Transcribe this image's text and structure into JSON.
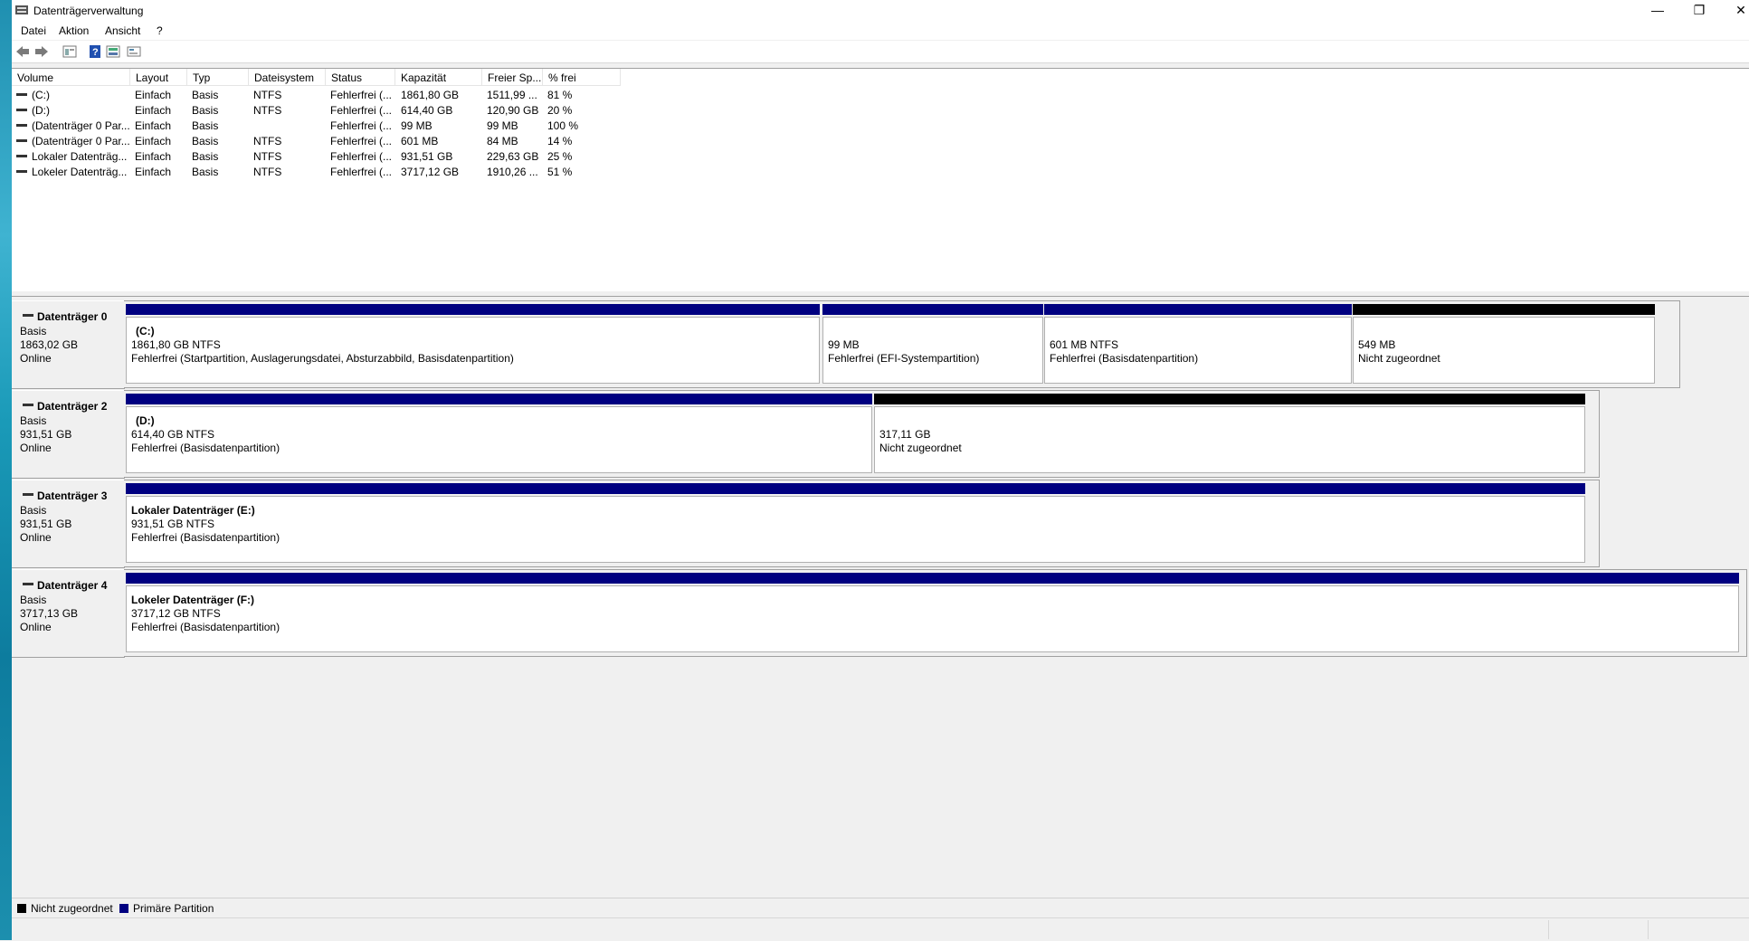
{
  "window": {
    "title": "Datenträgerverwaltung",
    "minimize": "—",
    "restore": "❐",
    "close": "✕"
  },
  "menu": {
    "datei": "Datei",
    "aktion": "Aktion",
    "ansicht": "Ansicht",
    "help": "?"
  },
  "columns": [
    "Volume",
    "Layout",
    "Typ",
    "Dateisystem",
    "Status",
    "Kapazität",
    "Freier Sp...",
    "% frei"
  ],
  "volumes": [
    {
      "volume": "(C:)",
      "layout": "Einfach",
      "typ": "Basis",
      "fs": "NTFS",
      "status": "Fehlerfrei (...",
      "kapazitaet": "1861,80 GB",
      "frei": "1511,99 ...",
      "prozent": "81 %"
    },
    {
      "volume": "(D:)",
      "layout": "Einfach",
      "typ": "Basis",
      "fs": "NTFS",
      "status": "Fehlerfrei (...",
      "kapazitaet": "614,40 GB",
      "frei": "120,90 GB",
      "prozent": "20 %"
    },
    {
      "volume": "(Datenträger 0 Par...",
      "layout": "Einfach",
      "typ": "Basis",
      "fs": "",
      "status": "Fehlerfrei (...",
      "kapazitaet": "99 MB",
      "frei": "99 MB",
      "prozent": "100 %"
    },
    {
      "volume": "(Datenträger 0 Par...",
      "layout": "Einfach",
      "typ": "Basis",
      "fs": "NTFS",
      "status": "Fehlerfrei (...",
      "kapazitaet": "601 MB",
      "frei": "84 MB",
      "prozent": "14 %"
    },
    {
      "volume": "Lokaler Datenträg...",
      "layout": "Einfach",
      "typ": "Basis",
      "fs": "NTFS",
      "status": "Fehlerfrei (...",
      "kapazitaet": "931,51 GB",
      "frei": "229,63 GB",
      "prozent": "25 %"
    },
    {
      "volume": "Lokeler Datenträg...",
      "layout": "Einfach",
      "typ": "Basis",
      "fs": "NTFS",
      "status": "Fehlerfrei (...",
      "kapazitaet": "3717,12 GB",
      "frei": "1910,26 ...",
      "prozent": "51 %"
    }
  ],
  "disks": [
    {
      "name": "Datenträger 0",
      "type": "Basis",
      "size": "1863,02 GB",
      "state": "Online",
      "partitions": [
        {
          "l1": "(C:)",
          "l2": "1861,80 GB NTFS",
          "l3": "Fehlerfrei (Startpartition, Auslagerungsdatei, Absturzabbild, Basisdatenpartition)",
          "kind": "primary"
        },
        {
          "l1": "",
          "l2": "99 MB",
          "l3": "Fehlerfrei (EFI-Systempartition)",
          "kind": "primary"
        },
        {
          "l1": "",
          "l2": "601 MB NTFS",
          "l3": "Fehlerfrei (Basisdatenpartition)",
          "kind": "primary"
        },
        {
          "l1": "",
          "l2": "549 MB",
          "l3": "Nicht zugeordnet",
          "kind": "unallocated"
        }
      ]
    },
    {
      "name": "Datenträger 2",
      "type": "Basis",
      "size": "931,51 GB",
      "state": "Online",
      "partitions": [
        {
          "l1": "(D:)",
          "l2": "614,40 GB NTFS",
          "l3": "Fehlerfrei (Basisdatenpartition)",
          "kind": "primary"
        },
        {
          "l1": "",
          "l2": "317,11 GB",
          "l3": "Nicht zugeordnet",
          "kind": "unallocated"
        }
      ]
    },
    {
      "name": "Datenträger 3",
      "type": "Basis",
      "size": "931,51 GB",
      "state": "Online",
      "partitions": [
        {
          "l1": "Lokaler Datenträger  (E:)",
          "l2": "931,51 GB NTFS",
          "l3": "Fehlerfrei (Basisdatenpartition)",
          "kind": "primary"
        }
      ]
    },
    {
      "name": "Datenträger 4",
      "type": "Basis",
      "size": "3717,13 GB",
      "state": "Online",
      "partitions": [
        {
          "l1": "Lokeler Datenträger  (F:)",
          "l2": "3717,12 GB NTFS",
          "l3": "Fehlerfrei (Basisdatenpartition)",
          "kind": "primary"
        }
      ]
    }
  ],
  "legend": {
    "unallocated": "Nicht zugeordnet",
    "primary": "Primäre Partition"
  },
  "colors": {
    "primary": "#000080",
    "unallocated": "#000000"
  },
  "icons": {
    "back": "arrow-left-icon",
    "forward": "arrow-right-icon",
    "properties": "properties-icon",
    "help": "help-icon",
    "view": "view-icon",
    "refresh": "rescan-icon"
  }
}
